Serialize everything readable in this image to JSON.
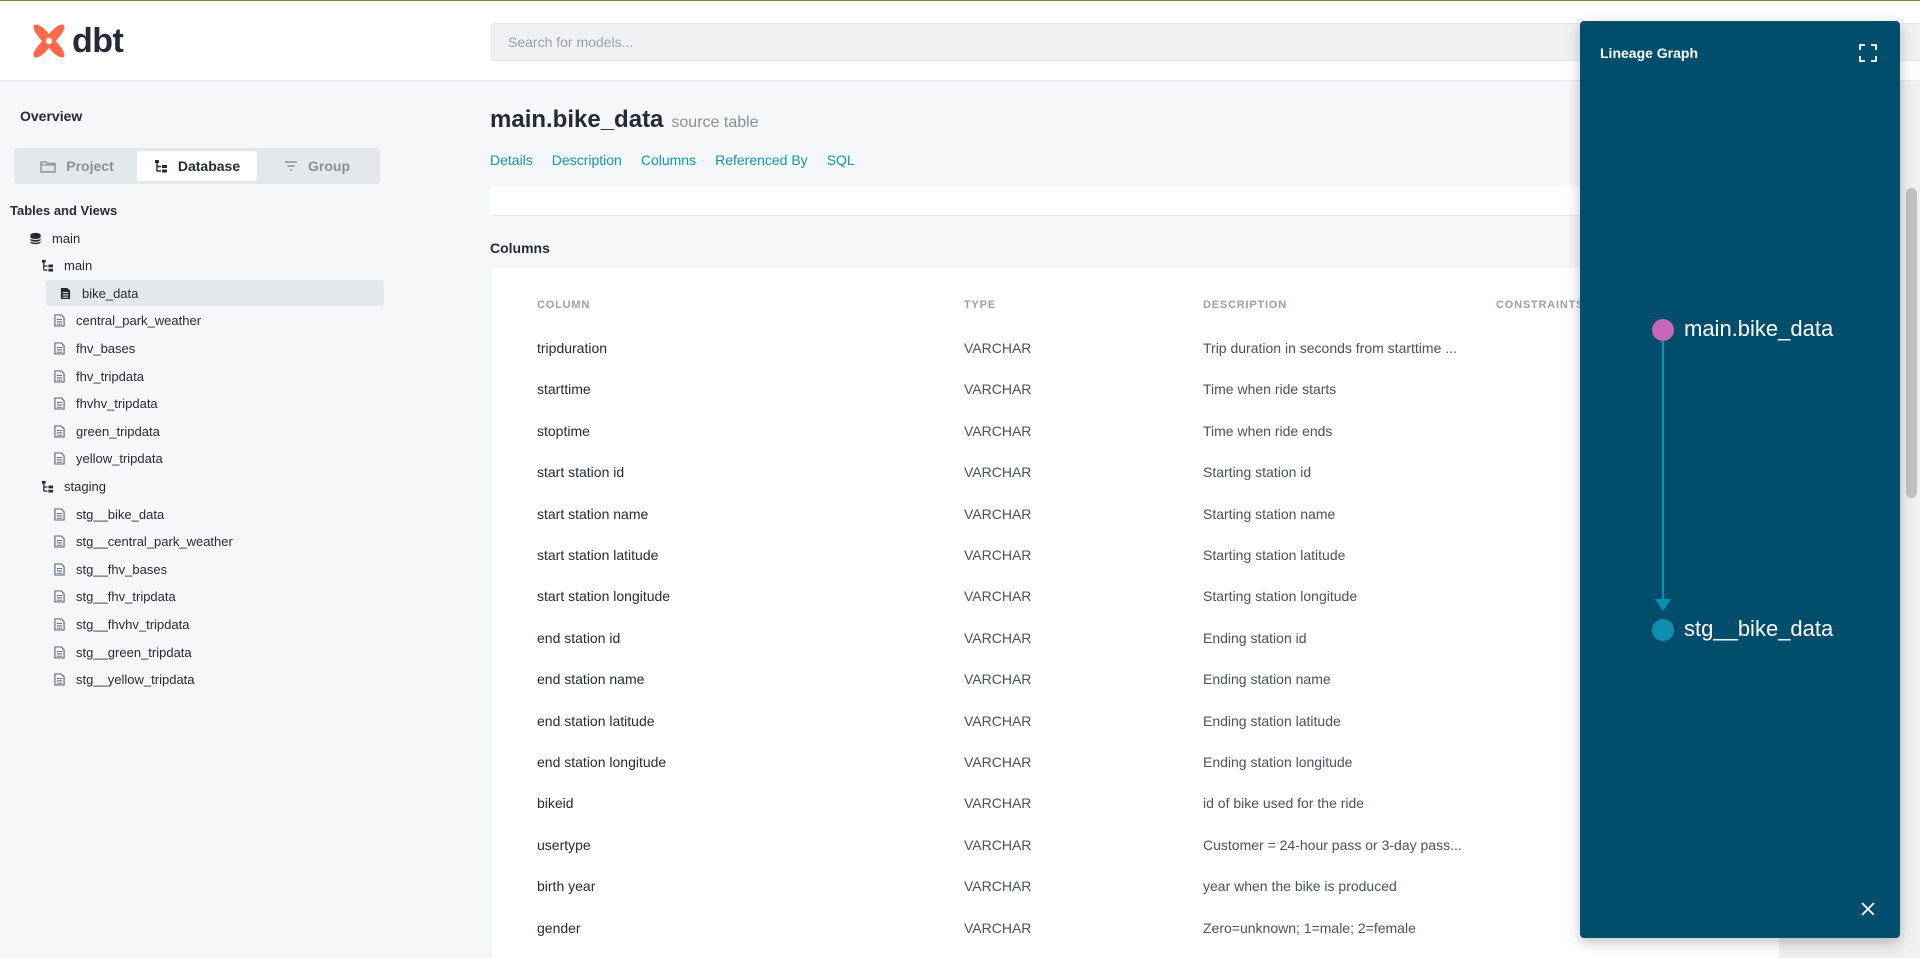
{
  "header": {
    "logo_text": "dbt",
    "search_placeholder": "Search for models..."
  },
  "sidebar": {
    "overview_label": "Overview",
    "tabs": [
      {
        "label": "Project",
        "icon": "folder-icon",
        "active": false
      },
      {
        "label": "Database",
        "icon": "tree-icon",
        "active": true
      },
      {
        "label": "Group",
        "icon": "filter-icon",
        "active": false
      }
    ],
    "section_title": "Tables and Views",
    "tree": [
      {
        "label": "main",
        "icon": "database-icon",
        "level": 0,
        "selected": false
      },
      {
        "label": "main",
        "icon": "schema-icon",
        "level": 1,
        "selected": false
      },
      {
        "label": "bike_data",
        "icon": "file-icon",
        "level": 2,
        "selected": true
      },
      {
        "label": "central_park_weather",
        "icon": "file-icon",
        "level": 2,
        "selected": false
      },
      {
        "label": "fhv_bases",
        "icon": "file-icon",
        "level": 2,
        "selected": false
      },
      {
        "label": "fhv_tripdata",
        "icon": "file-icon",
        "level": 2,
        "selected": false
      },
      {
        "label": "fhvhv_tripdata",
        "icon": "file-icon",
        "level": 2,
        "selected": false
      },
      {
        "label": "green_tripdata",
        "icon": "file-icon",
        "level": 2,
        "selected": false
      },
      {
        "label": "yellow_tripdata",
        "icon": "file-icon",
        "level": 2,
        "selected": false
      },
      {
        "label": "staging",
        "icon": "schema-icon",
        "level": 1,
        "selected": false
      },
      {
        "label": "stg__bike_data",
        "icon": "file-icon",
        "level": 2,
        "selected": false
      },
      {
        "label": "stg__central_park_weather",
        "icon": "file-icon",
        "level": 2,
        "selected": false
      },
      {
        "label": "stg__fhv_bases",
        "icon": "file-icon",
        "level": 2,
        "selected": false
      },
      {
        "label": "stg__fhv_tripdata",
        "icon": "file-icon",
        "level": 2,
        "selected": false
      },
      {
        "label": "stg__fhvhv_tripdata",
        "icon": "file-icon",
        "level": 2,
        "selected": false
      },
      {
        "label": "stg__green_tripdata",
        "icon": "file-icon",
        "level": 2,
        "selected": false
      },
      {
        "label": "stg__yellow_tripdata",
        "icon": "file-icon",
        "level": 2,
        "selected": false
      }
    ]
  },
  "main": {
    "title": "main.bike_data",
    "subtitle": "source table",
    "tabs": [
      "Details",
      "Description",
      "Columns",
      "Referenced By",
      "SQL"
    ],
    "columns_heading": "Columns",
    "table_headers": [
      "COLUMN",
      "TYPE",
      "DESCRIPTION",
      "CONSTRAINTS"
    ],
    "rows": [
      {
        "column": "tripduration",
        "type": "VARCHAR",
        "description": "Trip duration in seconds from starttime ..."
      },
      {
        "column": "starttime",
        "type": "VARCHAR",
        "description": "Time when ride starts"
      },
      {
        "column": "stoptime",
        "type": "VARCHAR",
        "description": "Time when ride ends"
      },
      {
        "column": "start station id",
        "type": "VARCHAR",
        "description": "Starting station id"
      },
      {
        "column": "start station name",
        "type": "VARCHAR",
        "description": "Starting station name"
      },
      {
        "column": "start station latitude",
        "type": "VARCHAR",
        "description": "Starting station latitude"
      },
      {
        "column": "start station longitude",
        "type": "VARCHAR",
        "description": "Starting station longitude"
      },
      {
        "column": "end station id",
        "type": "VARCHAR",
        "description": "Ending station id"
      },
      {
        "column": "end station name",
        "type": "VARCHAR",
        "description": "Ending station name"
      },
      {
        "column": "end station latitude",
        "type": "VARCHAR",
        "description": "Ending station latitude"
      },
      {
        "column": "end station longitude",
        "type": "VARCHAR",
        "description": "Ending station longitude"
      },
      {
        "column": "bikeid",
        "type": "VARCHAR",
        "description": "id of bike used for the ride"
      },
      {
        "column": "usertype",
        "type": "VARCHAR",
        "description": "Customer = 24-hour pass or 3-day pass..."
      },
      {
        "column": "birth year",
        "type": "VARCHAR",
        "description": "year when the bike is produced"
      },
      {
        "column": "gender",
        "type": "VARCHAR",
        "description": "Zero=unknown; 1=male; 2=female"
      }
    ]
  },
  "lineage": {
    "title": "Lineage Graph",
    "nodes": [
      {
        "label": "main.bike_data",
        "color": "#c566b8"
      },
      {
        "label": "stg__bike_data",
        "color": "#0e8fb2"
      }
    ],
    "expand_icon": "expand-icon",
    "close_icon": "close-icon"
  },
  "colors": {
    "accent": "#0e9aa7",
    "lineage_bg": "#004d6c",
    "logo": "#ff694a"
  }
}
